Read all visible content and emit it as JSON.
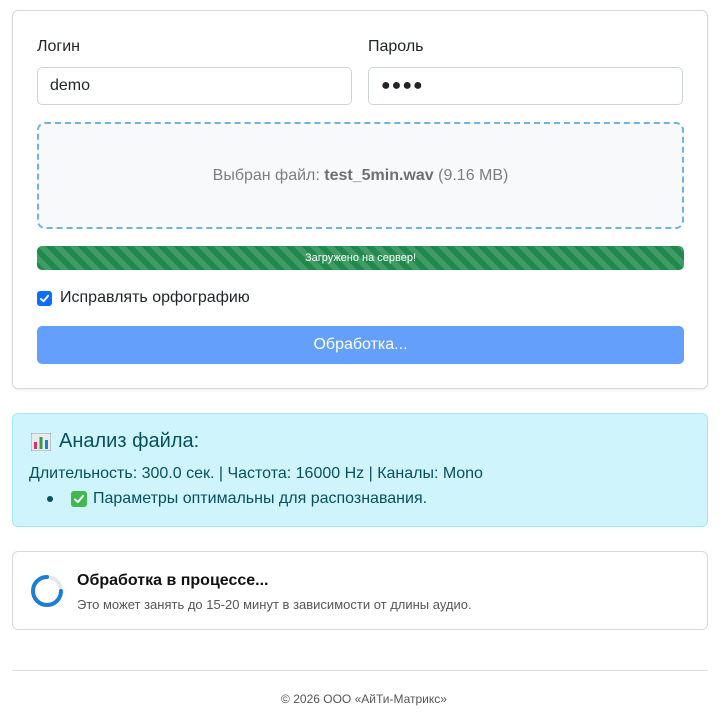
{
  "form": {
    "login_label": "Логин",
    "login_value": "demo",
    "password_label": "Пароль",
    "password_value": "●●●●",
    "dropzone": {
      "prefix": "Выбран файл: ",
      "filename": "test_5min.wav",
      "size": " (9.16 MB)"
    },
    "progress": {
      "label": "Загружено на сервер!",
      "percent": 100,
      "color": "#1f8a4c"
    },
    "spellcheck": {
      "label": "Исправлять орфографию",
      "checked": true
    },
    "submit_label": "Обработка..."
  },
  "analysis": {
    "icon": "bar-chart-icon",
    "title": "Анализ файла:",
    "details": "Длительность: 300.0 сек. | Частота: 16000 Hz | Каналы: Mono",
    "status_icon": "check-mark-icon",
    "status": "Параметры оптимальны для распознавания."
  },
  "processing": {
    "icon": "spinner-icon",
    "title": "Обработка в процессе...",
    "subtitle": "Это может занять до 15-20 минут в зависимости от длины аудио."
  },
  "footer": {
    "text": "© 2026 ООО «АйТи-Матрикс»"
  },
  "colors": {
    "accent": "#0d6efd",
    "button_disabled": "#64a0fb",
    "info_bg": "#cff4fc",
    "info_text": "#055160",
    "success": "#1f8a4c"
  }
}
